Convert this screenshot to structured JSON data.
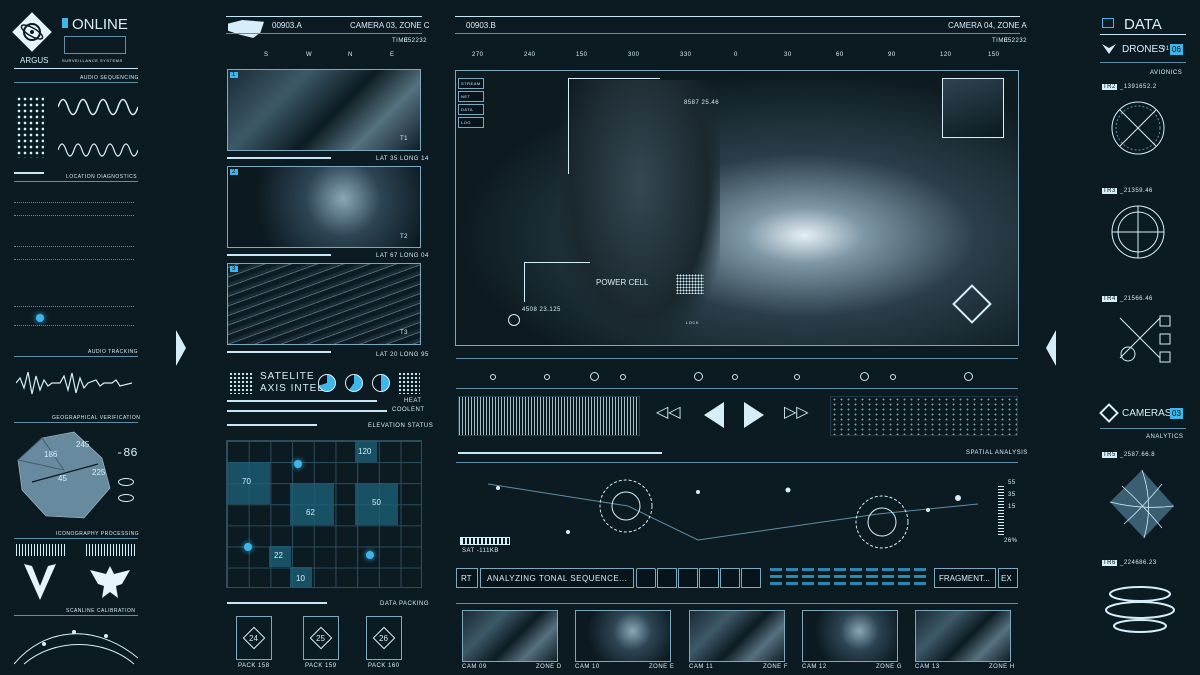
{
  "left": {
    "logo_label": "ARGUS",
    "status": "ONLINE",
    "surveillance": "SURVEILLANCE SYSTEMS",
    "sections": [
      "AUDIO SEQUENCING",
      "LOCATION DIAGNOSTICS",
      "AUDIO TRACKING",
      "GEOGRAPHICAL VERIFICATION",
      "ICONOGRAPHY PROCESSING",
      "SCANLINE CALIBRATION"
    ],
    "geo_numbers": [
      "186",
      "245",
      "225",
      "45"
    ],
    "geo_readout": "-86"
  },
  "mid": {
    "id": "00903.A",
    "camera": "CAMERA 03, ZONE C",
    "time_label": "TIME",
    "time": "052232",
    "compass": [
      "S",
      "W",
      "N",
      "E"
    ],
    "feeds": [
      {
        "n": "1",
        "coords": "LAT 35 LONG 14",
        "tag": "T1"
      },
      {
        "n": "2",
        "coords": "LAT 67 LONG 04",
        "tag": "T2"
      },
      {
        "n": "3",
        "coords": "LAT 20 LONG 95",
        "tag": "T3"
      }
    ],
    "sat_title": "SATELITE",
    "sat_sub": "AXIS INTEL",
    "heat": "HEAT",
    "coolant": "COOLENT",
    "elevation": "ELEVATION STATUS",
    "grid_values": [
      "120",
      "70",
      "50",
      "62",
      "22",
      "10"
    ],
    "data_packing": "DATA PACKING",
    "packs": [
      {
        "v": "24",
        "label": "PACK 158"
      },
      {
        "v": "25",
        "label": "PACK 159"
      },
      {
        "v": "26",
        "label": "PACK 160"
      }
    ]
  },
  "main": {
    "id": "00903.B",
    "camera": "CAMERA 04, ZONE A",
    "time_label": "TIME",
    "time": "052232",
    "ruler": [
      "270",
      "240",
      "150",
      "300",
      "330",
      "0",
      "30",
      "60",
      "90",
      "120",
      "150"
    ],
    "menu": [
      "STREAM",
      "NET",
      "DATA",
      "LOG"
    ],
    "power_cell": "POWER CELL",
    "coord1": "8587 25.46",
    "coord2": "4508 23.125",
    "lock": "LOCK",
    "spatial": "SPATIAL ANALYSIS",
    "sat_readout": "SAT -111KB",
    "scale_vals": [
      "55",
      "35",
      "15",
      "26%"
    ],
    "rt": "RT",
    "analyzing": "ANALYZING TONAL SEQUENCE...",
    "fragment": "FRAGMENT...",
    "ex": "EX",
    "cams": [
      {
        "cam": "CAM 09",
        "zone": "ZONE D"
      },
      {
        "cam": "CAM 10",
        "zone": "ZONE E"
      },
      {
        "cam": "CAM 11",
        "zone": "ZONE F"
      },
      {
        "cam": "CAM 12",
        "zone": "ZONE G"
      },
      {
        "cam": "CAM 13",
        "zone": "ZONE H"
      }
    ]
  },
  "right": {
    "data": "DATA",
    "data_count": "06",
    "drones": "DRONES",
    "drones_count": "01",
    "avionics": "AVIONICS",
    "cameras": "CAMERAS",
    "cameras_count": "03",
    "analytics": "ANALYTICS",
    "readouts": [
      "TR2",
      "TR3",
      "TR4",
      "TR5",
      "TR6"
    ],
    "values": [
      "_1391652.2",
      "_21359.46",
      "_21566.46",
      "_2587.66.8",
      "_224686.23"
    ]
  }
}
